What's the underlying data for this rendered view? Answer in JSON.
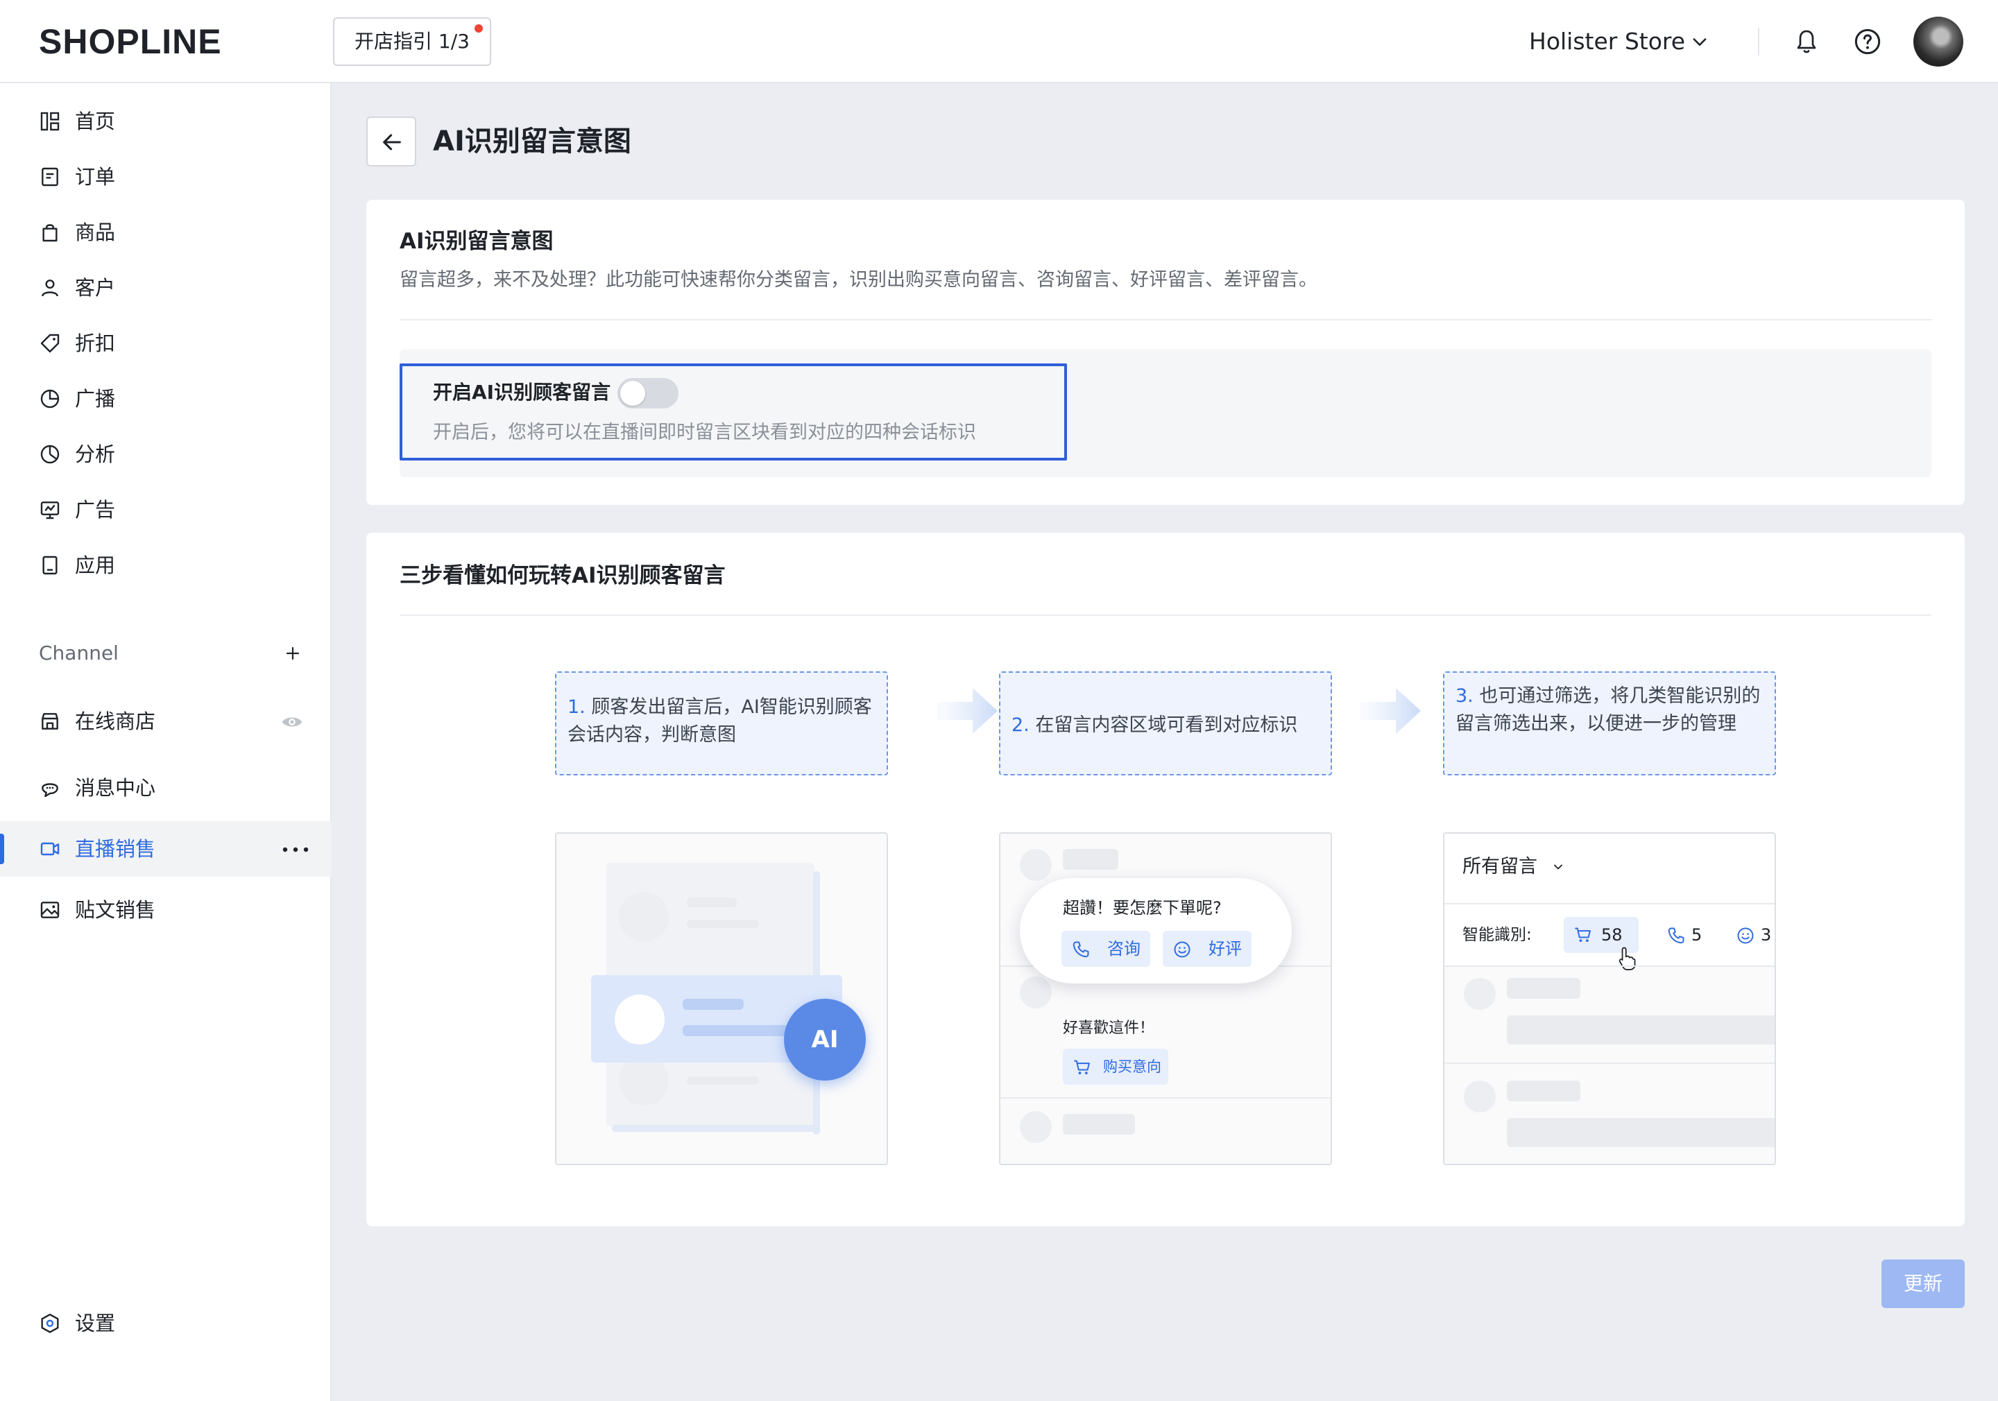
{
  "header": {
    "logo": "SHOPLINE",
    "guide_label": "开店指引 1/3",
    "store_name": "Holister Store",
    "icons": [
      "bell-icon",
      "help-icon",
      "chevron-down-icon"
    ],
    "accent_color": "#2F6BE0"
  },
  "sidebar": {
    "items": [
      {
        "label": "首页",
        "icon": "dashboard-icon"
      },
      {
        "label": "订单",
        "icon": "order-icon"
      },
      {
        "label": "商品",
        "icon": "bag-icon"
      },
      {
        "label": "客户",
        "icon": "user-icon"
      },
      {
        "label": "折扣",
        "icon": "tag-icon"
      },
      {
        "label": "广播",
        "icon": "broadcast-icon"
      },
      {
        "label": "分析",
        "icon": "pie-chart-icon"
      },
      {
        "label": "广告",
        "icon": "ad-icon"
      },
      {
        "label": "应用",
        "icon": "app-icon"
      }
    ],
    "channel_header": "Channel",
    "channel_items": [
      {
        "label": "在线商店",
        "icon": "store-icon"
      },
      {
        "label": "消息中心",
        "icon": "message-icon"
      },
      {
        "label": "直播销售",
        "icon": "video-icon",
        "active": true
      },
      {
        "label": "贴文销售",
        "icon": "image-icon"
      }
    ],
    "settings_label": "设置"
  },
  "main": {
    "title": "AI识别留言意图",
    "section1": {
      "title": "AI识别留言意图",
      "description": "留言超多，来不及处理？此功能可快速帮你分类留言，识别出购买意向留言、咨询留言、好评留言、差评留言。",
      "toggle_label": "开启AI识别顾客留言",
      "toggle_on": false,
      "toggle_hint": "开启后，您将可以在直播间即时留言区块看到对应的四种会话标识"
    },
    "section2": {
      "title": "三步看懂如何玩转AI识别顾客留言",
      "steps": [
        {
          "num": "1.",
          "text": "顾客发出留言后，AI智能识别顾客会话内容，判断意图"
        },
        {
          "num": "2.",
          "text": "在留言内容区域可看到对应标识"
        },
        {
          "num": "3.",
          "text": "也可通过筛选，将几类智能识别的留言筛选出来，以便进一步的管理"
        }
      ],
      "illus1": {
        "badge": "AI"
      },
      "illus2": {
        "question": "超讚！要怎麼下單呢?",
        "tag_consult": "咨询",
        "tag_praise": "好评",
        "comment": "好喜歡這件！",
        "tag_buy": "购买意向"
      },
      "illus3": {
        "filter_label": "所有留言",
        "smart_label": "智能識別:",
        "count_buy": "58",
        "count_consult": "5",
        "count_praise": "3"
      }
    },
    "update_button": "更新"
  }
}
